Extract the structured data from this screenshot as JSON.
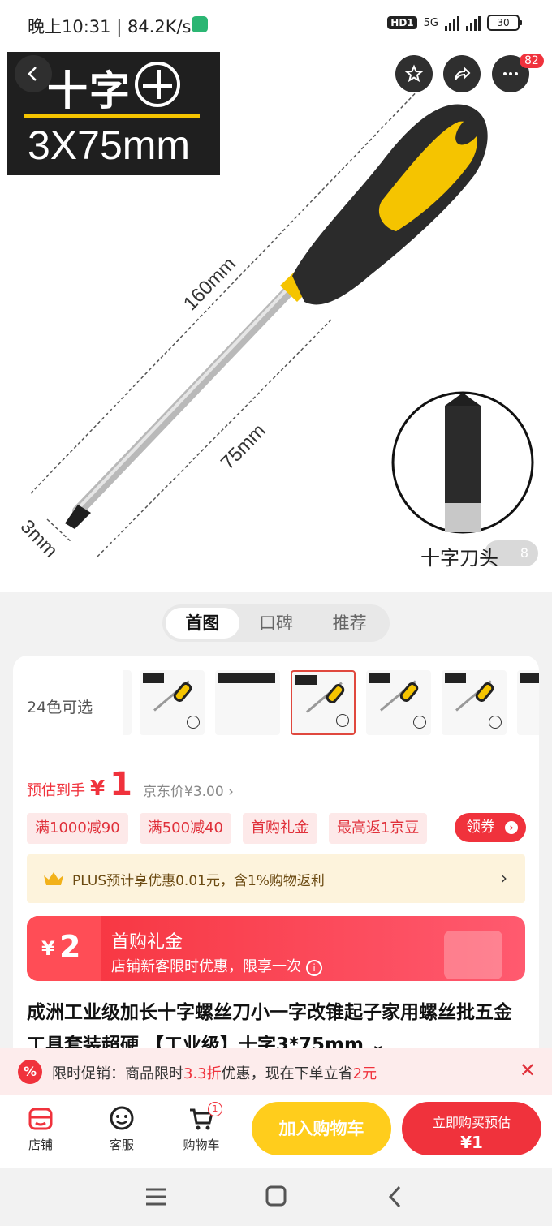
{
  "status_bar": {
    "time": "晚上10:31 | 84.2K/s",
    "hd": "HD1",
    "net": "5G",
    "battery": "30"
  },
  "hero": {
    "spec_line1": "十字",
    "spec_line2": "3X75mm",
    "dim_total": "160mm",
    "dim_shaft": "75mm",
    "dim_tip": "3mm",
    "tip_label": "十字刀头",
    "page_counter": "8",
    "more_badge": "82"
  },
  "tabs": [
    "首图",
    "口碑",
    "推荐"
  ],
  "variants": {
    "count_label": "24色可选"
  },
  "price": {
    "est_label": "预估到手",
    "currency": "¥",
    "est_value": "1",
    "jd_price": "京东价¥3.00 ›"
  },
  "coupons": [
    "满1000减90",
    "满500减40",
    "首购礼金",
    "最高返1京豆"
  ],
  "get_coupon": "领券",
  "plus": {
    "text": "PLUS预计享优惠0.01元，含1%购物返利",
    "chevron": "›"
  },
  "gift": {
    "currency": "¥",
    "amount": "2",
    "title": "首购礼金",
    "subtitle": "店铺新客限时优惠，限享一次",
    "info": "i"
  },
  "product_title": "成洲工业级加长十字螺丝刀小一字改锥起子家用螺丝批五金工具套装超硬 【工业级】十字3*75mm ⌄",
  "promo": {
    "prefix": "限时促销：商品限时",
    "discount": "3.3折",
    "middle": "优惠，现在下单立省",
    "save": "2元",
    "close": "✕",
    "icon": "%"
  },
  "bottom": {
    "shop": "店铺",
    "service": "客服",
    "cart": "购物车",
    "cart_count": "1",
    "add_cart": "加入购物车",
    "buy_line1": "立即购买预估",
    "buy_line2": "¥1"
  },
  "colors": {
    "brand_red": "#f0323c",
    "cart_yellow": "#ffcd1c",
    "handle_yellow": "#f5c400"
  }
}
